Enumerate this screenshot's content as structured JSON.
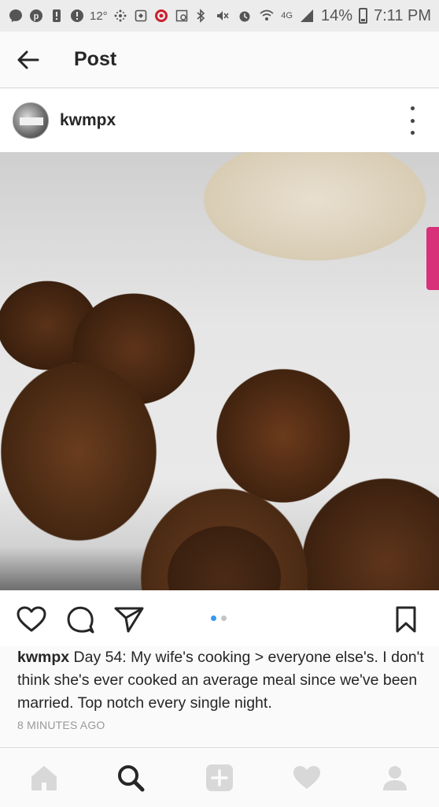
{
  "status_bar": {
    "temperature": "12°",
    "network": "4G",
    "battery": "14%",
    "time": "7:11 PM"
  },
  "header": {
    "title": "Post",
    "back_icon": "arrow-left-icon"
  },
  "post": {
    "username": "kwmpx",
    "caption_user": "kwmpx",
    "caption_text": " Day 54: My wife's cooking > everyone else's. I don't think she's ever cooked an average meal since we've been married. Top notch every single night.",
    "timestamp": "8 MINUTES AGO",
    "carousel": {
      "count": 2,
      "active_index": 0
    }
  },
  "actions": [
    "heart-icon",
    "comment-icon",
    "share-icon",
    "bookmark-icon"
  ],
  "bottom_nav": [
    "home-icon",
    "search-icon",
    "add-icon",
    "activity-heart-icon",
    "profile-icon"
  ],
  "colors": {
    "accent": "#3897f0",
    "text": "#262626",
    "muted": "#999999",
    "divider": "#dbdbdb"
  }
}
